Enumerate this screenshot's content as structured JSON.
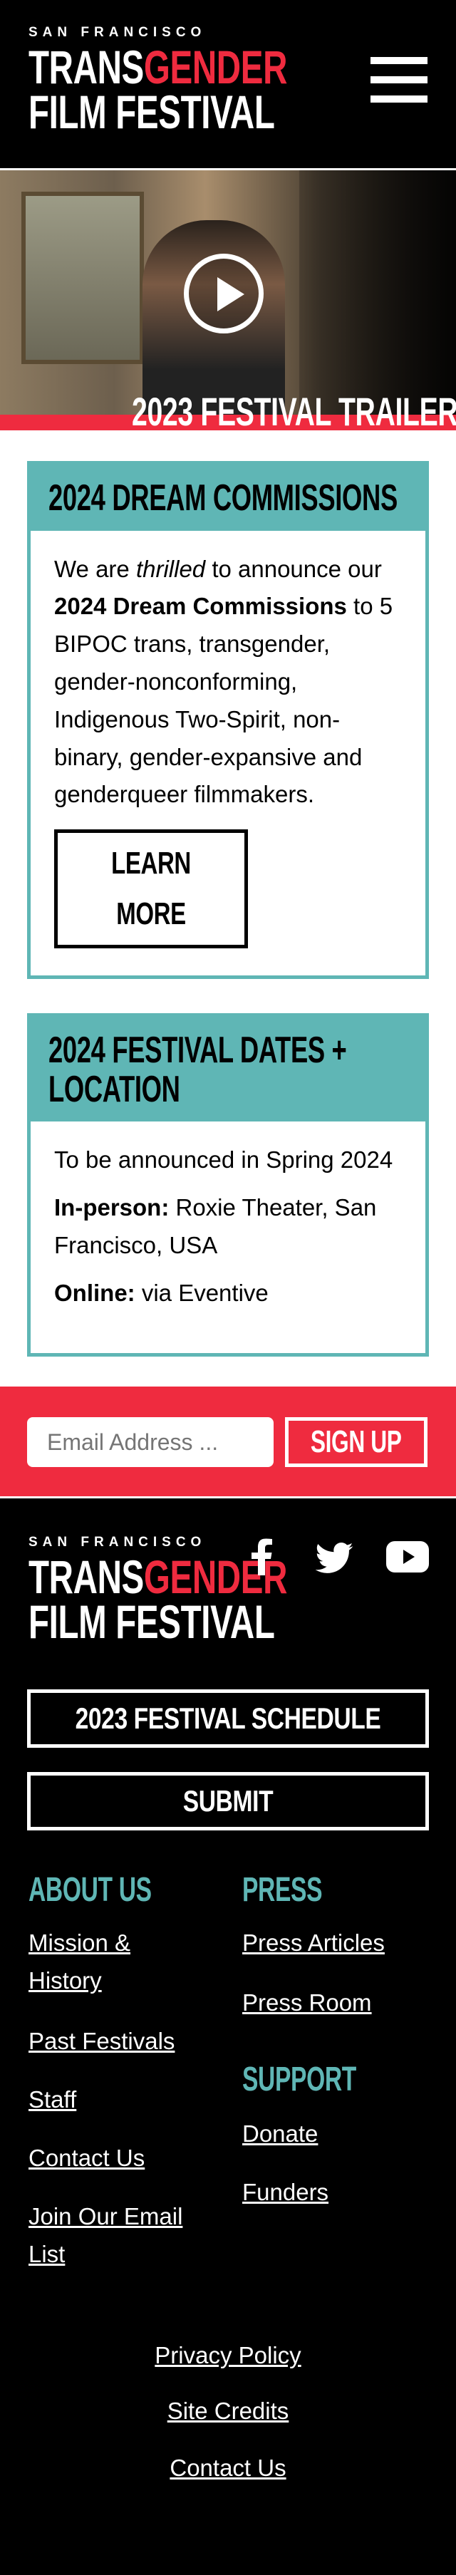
{
  "logo": {
    "top": "SAN FRANCISCO",
    "line1_white": "TRANS",
    "line1_red": "GENDER",
    "line2": "FILM FESTIVAL"
  },
  "hero": {
    "caption": "2023 FESTIVAL TRAILER"
  },
  "cards": [
    {
      "title": "2024 DREAM COMMISSIONS",
      "text_a": "We are ",
      "text_em": "thrilled",
      "text_b": " to announce our ",
      "text_strong": "2024 Dream Commissions",
      "text_c": " to 5 BIPOC trans, transgender, gender-nonconforming, Indigenous Two-Spirit, non-binary, gender-expansive and genderqueer filmmakers.",
      "button": "LEARN MORE"
    },
    {
      "title_line1": "2024 FESTIVAL DATES +",
      "title_line2": "LOCATION",
      "line1": "To be announced in Spring 2024",
      "inperson_label": "In-person:",
      "inperson_value": " Roxie Theater, San Francisco, USA",
      "online_label": "Online:",
      "online_value": " via Eventive"
    }
  ],
  "signup": {
    "placeholder": "Email Address ...",
    "button": "SIGN UP"
  },
  "footer": {
    "schedule_button": "2023 FESTIVAL SCHEDULE",
    "submit_button": "SUBMIT",
    "about_heading": "ABOUT US",
    "about_links": [
      "Mission & History",
      "Past Festivals",
      "Staff",
      "Contact Us",
      "Join Our Email List"
    ],
    "press_heading": "PRESS",
    "press_links": [
      "Press Articles",
      "Press Room"
    ],
    "support_heading": "SUPPORT",
    "support_links": [
      "Donate",
      "Funders"
    ],
    "bottom_links": [
      "Privacy Policy",
      "Site Credits",
      "Contact Us"
    ]
  },
  "icons": [
    "menu-icon",
    "play-icon",
    "facebook-icon",
    "twitter-icon",
    "youtube-icon"
  ],
  "colors": {
    "accent_red": "#ef2b3f",
    "teal": "#5fb6b5",
    "black": "#000000",
    "white": "#ffffff"
  }
}
